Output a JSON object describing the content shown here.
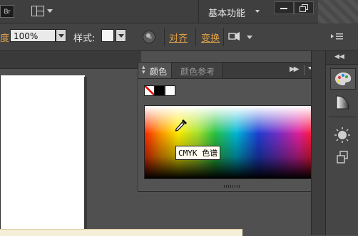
{
  "menubar": {
    "bridge_icon_text": "Br",
    "workspace_label": "基本功能"
  },
  "controlbar": {
    "opacity_label": "度:",
    "opacity_value": "100%",
    "style_label": "样式:",
    "align_link": "对齐",
    "transform_link": "变换"
  },
  "color_panel": {
    "tab_color": "颜色",
    "tab_color_guide": "颜色参考",
    "collapse_glyph": "▶▶",
    "spectrum_tooltip": "CMYK 色谱"
  },
  "colors": {
    "accent_orange": "#e0a34a",
    "panel_bg": "#535353",
    "app_bg": "#505050"
  },
  "icons": {
    "bridge": "bridge-icon",
    "arrange_documents": "arrange-documents-icon",
    "minimize": "minimize-icon",
    "restore": "restore-icon",
    "recolor": "recolor-artwork-icon",
    "isolate": "isolate-selection-icon",
    "eyedropper": "eyedropper-icon",
    "palette": "palette-icon",
    "gradient": "gradient-icon",
    "appearance": "sun-icon",
    "layers": "layers-icon"
  }
}
